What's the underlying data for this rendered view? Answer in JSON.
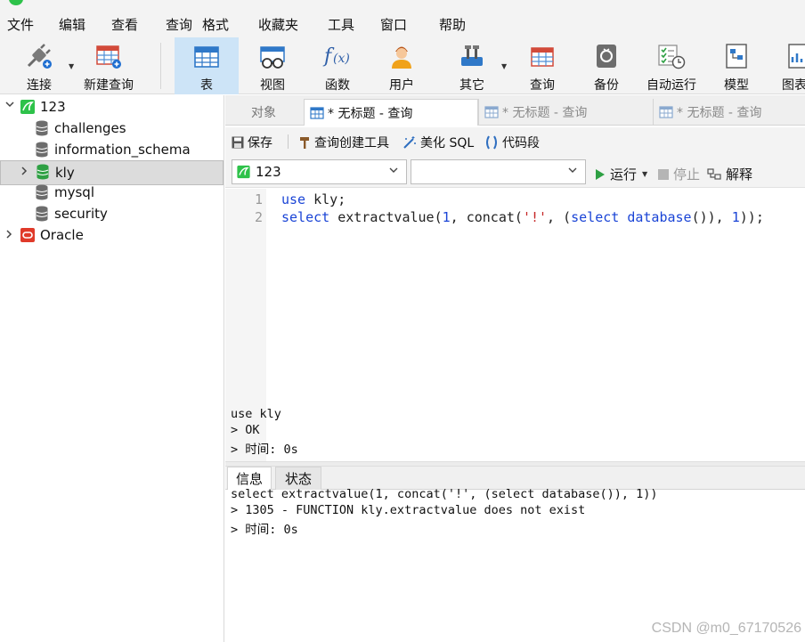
{
  "menubar": {
    "items": [
      "文件",
      "编辑",
      "查看",
      "查询",
      "格式",
      "收藏夹",
      "工具",
      "窗口",
      "帮助"
    ]
  },
  "toolbar": {
    "buttons": [
      {
        "label": "连接",
        "icon": "plug-connect-icon"
      },
      {
        "label": "新建查询",
        "icon": "new-query-table-icon"
      },
      {
        "label": "表",
        "icon": "table-icon"
      },
      {
        "label": "视图",
        "icon": "view-glasses-icon"
      },
      {
        "label": "函数",
        "icon": "function-fx-icon"
      },
      {
        "label": "用户",
        "icon": "user-icon"
      },
      {
        "label": "其它",
        "icon": "tools-icon"
      },
      {
        "label": "查询",
        "icon": "query-table-icon"
      },
      {
        "label": "备份",
        "icon": "backup-icon"
      },
      {
        "label": "自动运行",
        "icon": "auto-run-checklist-icon"
      },
      {
        "label": "模型",
        "icon": "model-icon"
      },
      {
        "label": "图表",
        "icon": "chart-icon"
      }
    ]
  },
  "tree": {
    "connection_123": "123",
    "databases": [
      "challenges",
      "information_schema",
      "kly",
      "mysql",
      "security"
    ],
    "connection_oracle": "Oracle",
    "selected": "kly"
  },
  "tabs": {
    "object_tab": "对象",
    "query_tabs": [
      "* 无标题 - 查询",
      "* 无标题 - 查询",
      "* 无标题 - 查询"
    ]
  },
  "query_toolbar": {
    "save": "保存",
    "query_builder": "查询创建工具",
    "beautify": "美化 SQL",
    "snippet": "代码段"
  },
  "selectors": {
    "connection_value": "123",
    "database_value": "",
    "run": "运行",
    "stop": "停止",
    "explain": "解释"
  },
  "editor": {
    "line_numbers": [
      "1",
      "2"
    ]
  },
  "results": {
    "tabs": [
      "信息",
      "状态"
    ],
    "lines": [
      "use kly",
      "> OK",
      "> 时间: 0s",
      "",
      "",
      "select extractvalue(1, concat('!', (select database()), 1))",
      "> 1305 - FUNCTION kly.extractvalue does not exist",
      "> 时间: 0s"
    ]
  },
  "watermark": "CSDN @m0_67170526",
  "colors": {
    "accent_green": "#2ec24a",
    "keyword_blue": "#1a44d6",
    "string_red": "#c52626",
    "active_toolbar": "#cde4f7"
  }
}
